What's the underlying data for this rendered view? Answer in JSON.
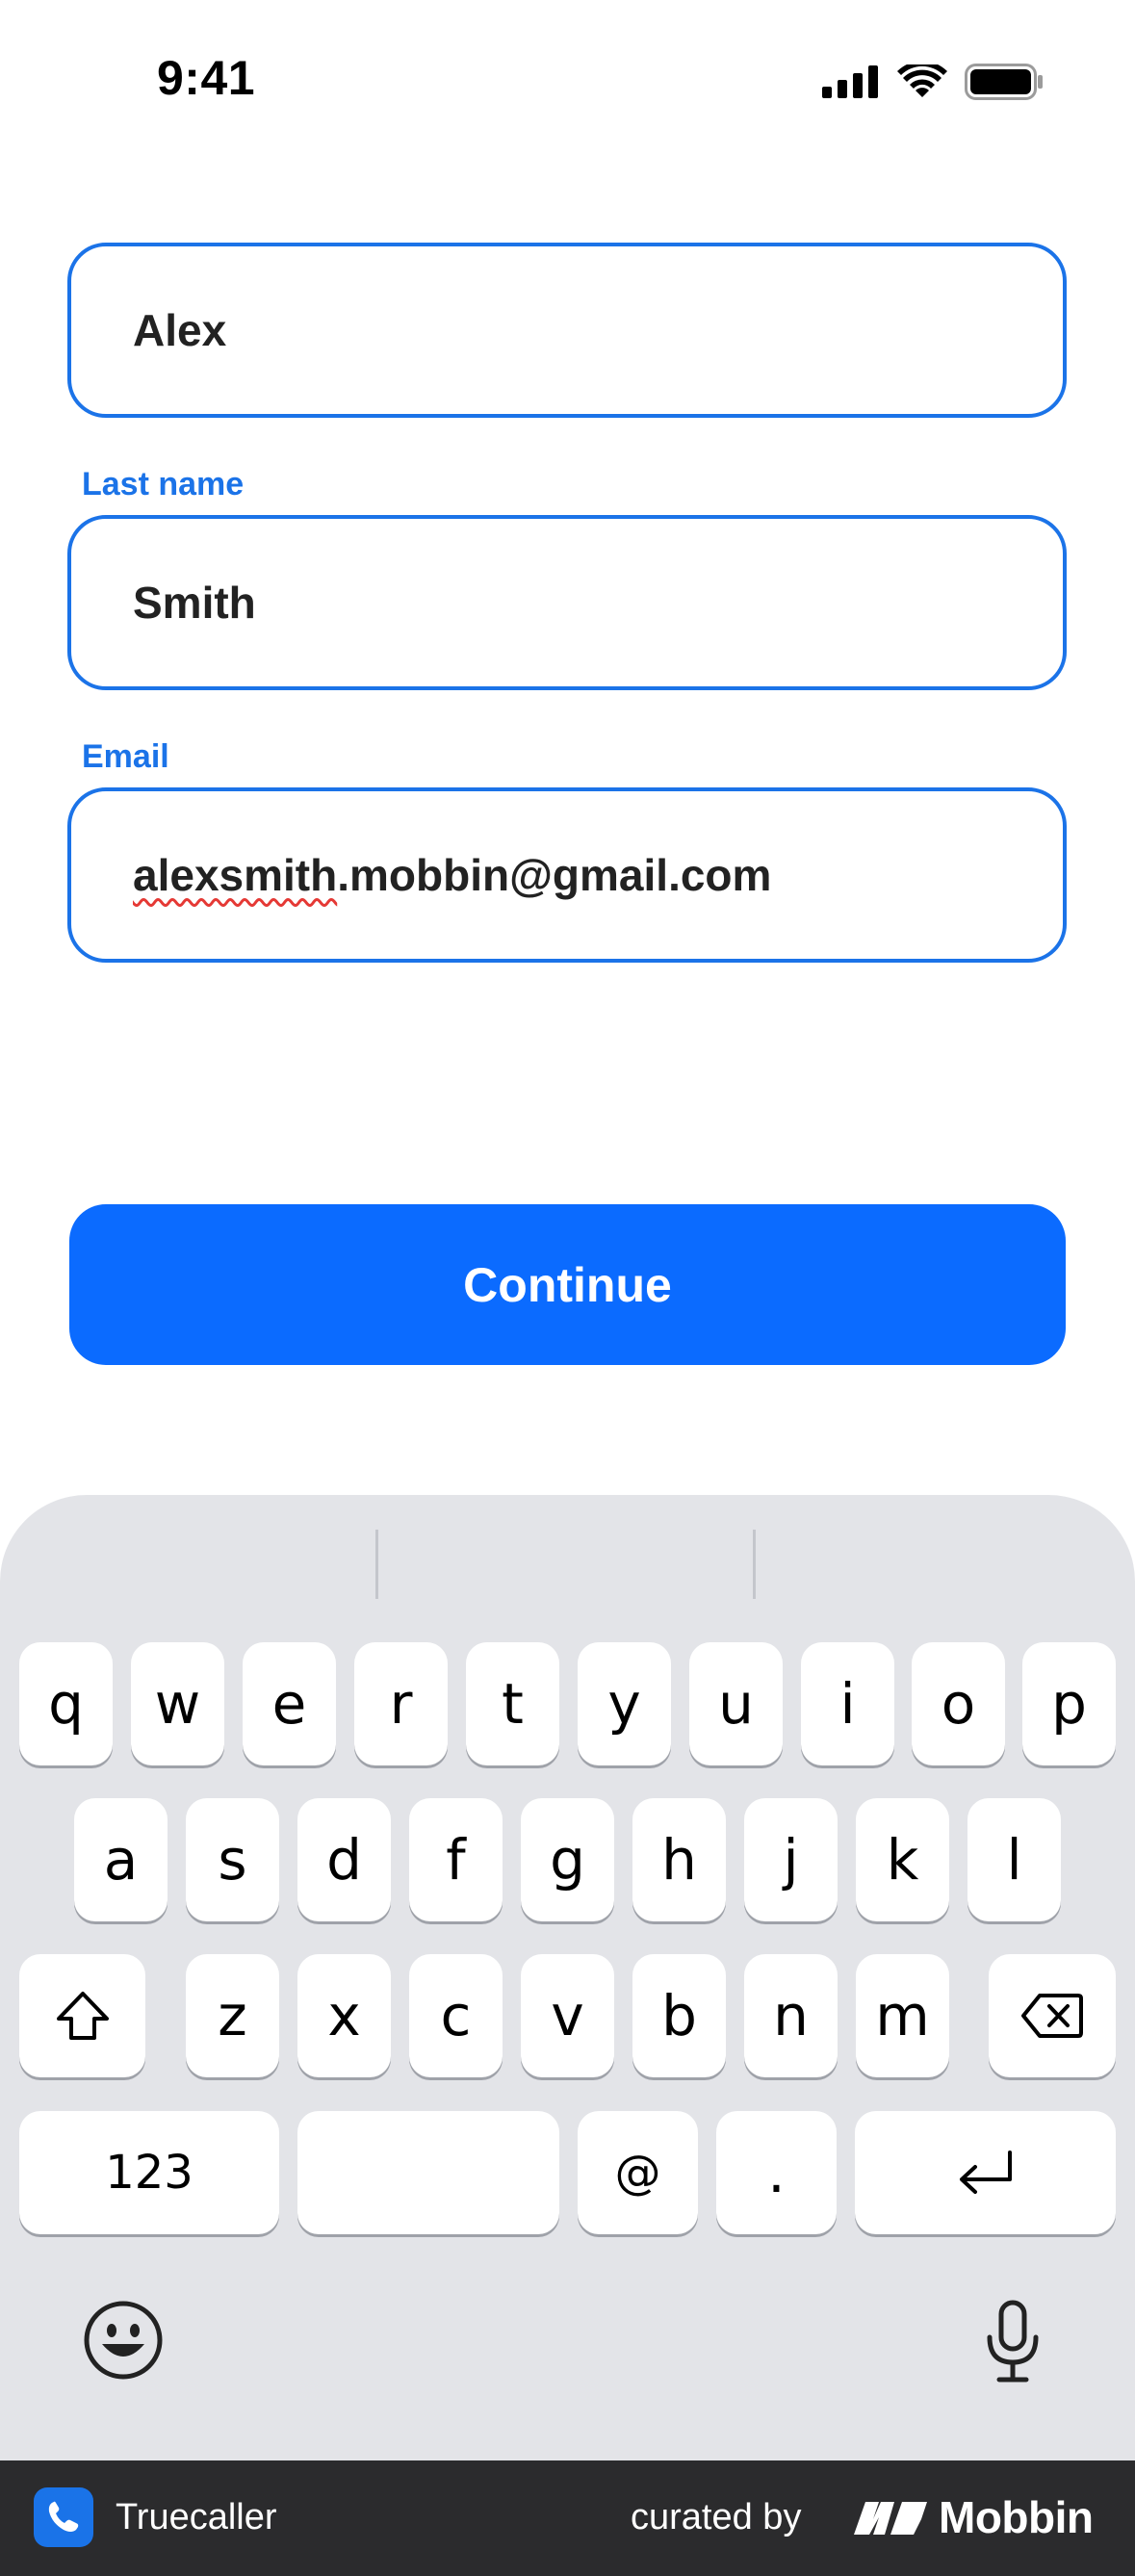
{
  "status_bar": {
    "time": "9:41",
    "icons": [
      "cellular-signal-icon",
      "wifi-icon",
      "battery-icon"
    ]
  },
  "form": {
    "first_name": {
      "value": "Alex"
    },
    "last_name": {
      "label": "Last name",
      "value": "Smith"
    },
    "email": {
      "label": "Email",
      "value_underlined": "alexsmith",
      "value_rest": ".mobbin@gmail.com"
    },
    "accent_color": "#1b73e8"
  },
  "continue_button": {
    "label": "Continue",
    "color": "#0b6bff"
  },
  "keyboard": {
    "row1": [
      "q",
      "w",
      "e",
      "r",
      "t",
      "y",
      "u",
      "i",
      "o",
      "p"
    ],
    "row2": [
      "a",
      "s",
      "d",
      "f",
      "g",
      "h",
      "j",
      "k",
      "l"
    ],
    "row3": [
      "z",
      "x",
      "c",
      "v",
      "b",
      "n",
      "m"
    ],
    "numbers_key": "123",
    "at_key": "@",
    "period_key": ".",
    "icons": [
      "shift-icon",
      "delete-icon",
      "return-icon",
      "emoji-icon",
      "microphone-icon"
    ]
  },
  "footer": {
    "app_name": "Truecaller",
    "curated_by": "curated by",
    "brand": "Mobbin"
  }
}
